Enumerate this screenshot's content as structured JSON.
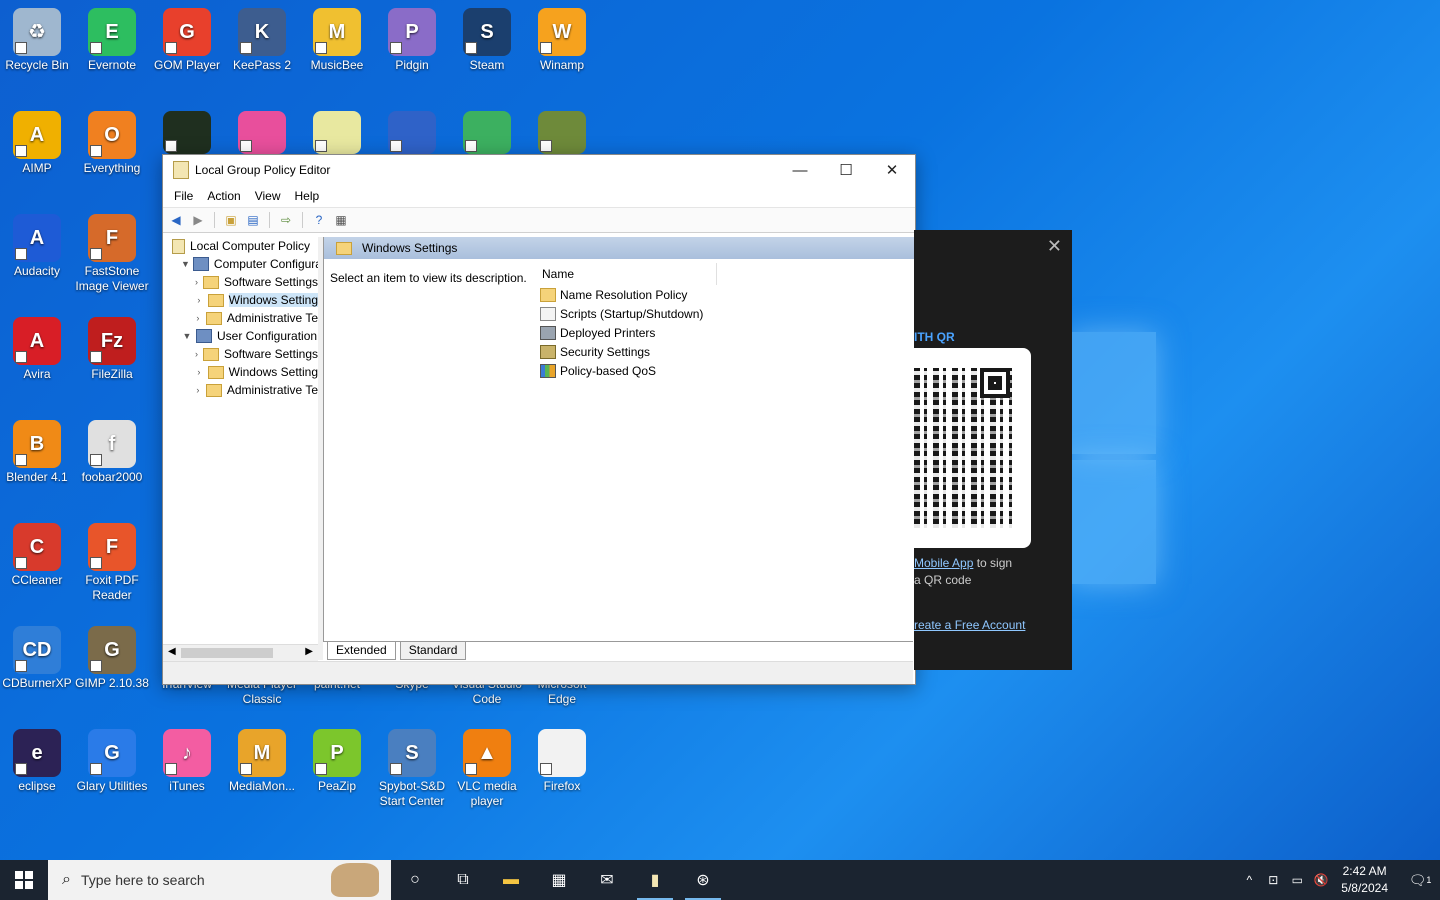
{
  "desktop": {
    "icons": [
      {
        "label": "Recycle Bin",
        "color": "#9fb7cf",
        "glyph": "♻"
      },
      {
        "label": "Evernote",
        "color": "#2dbe60",
        "glyph": "E"
      },
      {
        "label": "GOM Player",
        "color": "#e8402c",
        "glyph": "G"
      },
      {
        "label": "KeePass 2",
        "color": "#3d5d8f",
        "glyph": "K"
      },
      {
        "label": "MusicBee",
        "color": "#f0c030",
        "glyph": "M"
      },
      {
        "label": "Pidgin",
        "color": "#8a6cc8",
        "glyph": "P"
      },
      {
        "label": "Steam",
        "color": "#1b3f6e",
        "glyph": "S"
      },
      {
        "label": "Winamp",
        "color": "#f6a21e",
        "glyph": "W"
      },
      {
        "label": "AIMP",
        "color": "#f0b000",
        "glyph": "A"
      },
      {
        "label": "Everything",
        "color": "#f08020",
        "glyph": "O"
      },
      {
        "label": "Audacity",
        "color": "#1e5bd6",
        "glyph": "A"
      },
      {
        "label": "FastStone Image Viewer",
        "color": "#d66a2a",
        "glyph": "F"
      },
      {
        "label": "Avira",
        "color": "#d81e26",
        "glyph": "A"
      },
      {
        "label": "FileZilla",
        "color": "#bf1e1e",
        "glyph": "Fz"
      },
      {
        "label": "Blender 4.1",
        "color": "#f08a16",
        "glyph": "B"
      },
      {
        "label": "foobar2000",
        "color": "#e0e0e0",
        "glyph": "f"
      },
      {
        "label": "CCleaner",
        "color": "#d83a2c",
        "glyph": "C"
      },
      {
        "label": "Foxit PDF Reader",
        "color": "#e8552a",
        "glyph": "F"
      },
      {
        "label": "CDBurnerXP",
        "color": "#2f7ed8",
        "glyph": "CD"
      },
      {
        "label": "GIMP 2.10.38",
        "color": "#7b6b4a",
        "glyph": "G"
      },
      {
        "label": "eclipse",
        "color": "#2c2255",
        "glyph": "e"
      },
      {
        "label": "Glary Utilities",
        "color": "#2a7be8",
        "glyph": "G"
      },
      {
        "label": "iTunes",
        "color": "#f35da2",
        "glyph": "♪"
      },
      {
        "label": "MediaMon...",
        "color": "#e8a42a",
        "glyph": "M"
      },
      {
        "label": "PeaZip",
        "color": "#7cc62c",
        "glyph": "P"
      },
      {
        "label": "Spybot-S&D Start Center",
        "color": "#4a7fc0",
        "glyph": "S"
      },
      {
        "label": "VLC media player",
        "color": "#f07f10",
        "glyph": "▲"
      },
      {
        "label": "Firefox",
        "color": "#f2f2f2",
        "glyph": ""
      }
    ],
    "partial_labels": [
      "IrfanView",
      "Media Player Classic",
      "paint.net",
      "Skype",
      "Visual Studio Code",
      "Microsoft Edge"
    ]
  },
  "window": {
    "title": "Local Group Policy Editor",
    "menu": [
      "File",
      "Action",
      "View",
      "Help"
    ],
    "tree": [
      {
        "label": "Local Computer Policy",
        "level": 0,
        "expander": "",
        "icon": "doc"
      },
      {
        "label": "Computer Configura",
        "level": 1,
        "expander": "▼",
        "icon": "pc"
      },
      {
        "label": "Software Settings",
        "level": 2,
        "expander": "›",
        "icon": "folder"
      },
      {
        "label": "Windows Setting",
        "level": 2,
        "expander": "›",
        "icon": "folder",
        "selected": true
      },
      {
        "label": "Administrative Te",
        "level": 2,
        "expander": "›",
        "icon": "folder"
      },
      {
        "label": "User Configuration",
        "level": 1,
        "expander": "▼",
        "icon": "pc"
      },
      {
        "label": "Software Settings",
        "level": 2,
        "expander": "›",
        "icon": "folder"
      },
      {
        "label": "Windows Setting",
        "level": 2,
        "expander": "›",
        "icon": "folder"
      },
      {
        "label": "Administrative Te",
        "level": 2,
        "expander": "›",
        "icon": "folder"
      }
    ],
    "detail_header": "Windows Settings",
    "description": "Select an item to view its description.",
    "column_name": "Name",
    "items": [
      {
        "label": "Name Resolution Policy",
        "icon": "folder"
      },
      {
        "label": "Scripts (Startup/Shutdown)",
        "icon": "doc"
      },
      {
        "label": "Deployed Printers",
        "icon": "printer"
      },
      {
        "label": "Security Settings",
        "icon": "security"
      },
      {
        "label": "Policy-based QoS",
        "icon": "chart"
      }
    ],
    "tabs": [
      "Extended",
      "Standard"
    ]
  },
  "qr_popup": {
    "heading": "ITH QR",
    "line1_link": "Mobile App",
    "line1_rest": " to sign",
    "line2": "a QR code",
    "create_link": "reate a Free Account"
  },
  "taskbar": {
    "search_placeholder": "Type here to search",
    "time": "2:42 AM",
    "date": "5/8/2024",
    "notification_count": "1"
  }
}
